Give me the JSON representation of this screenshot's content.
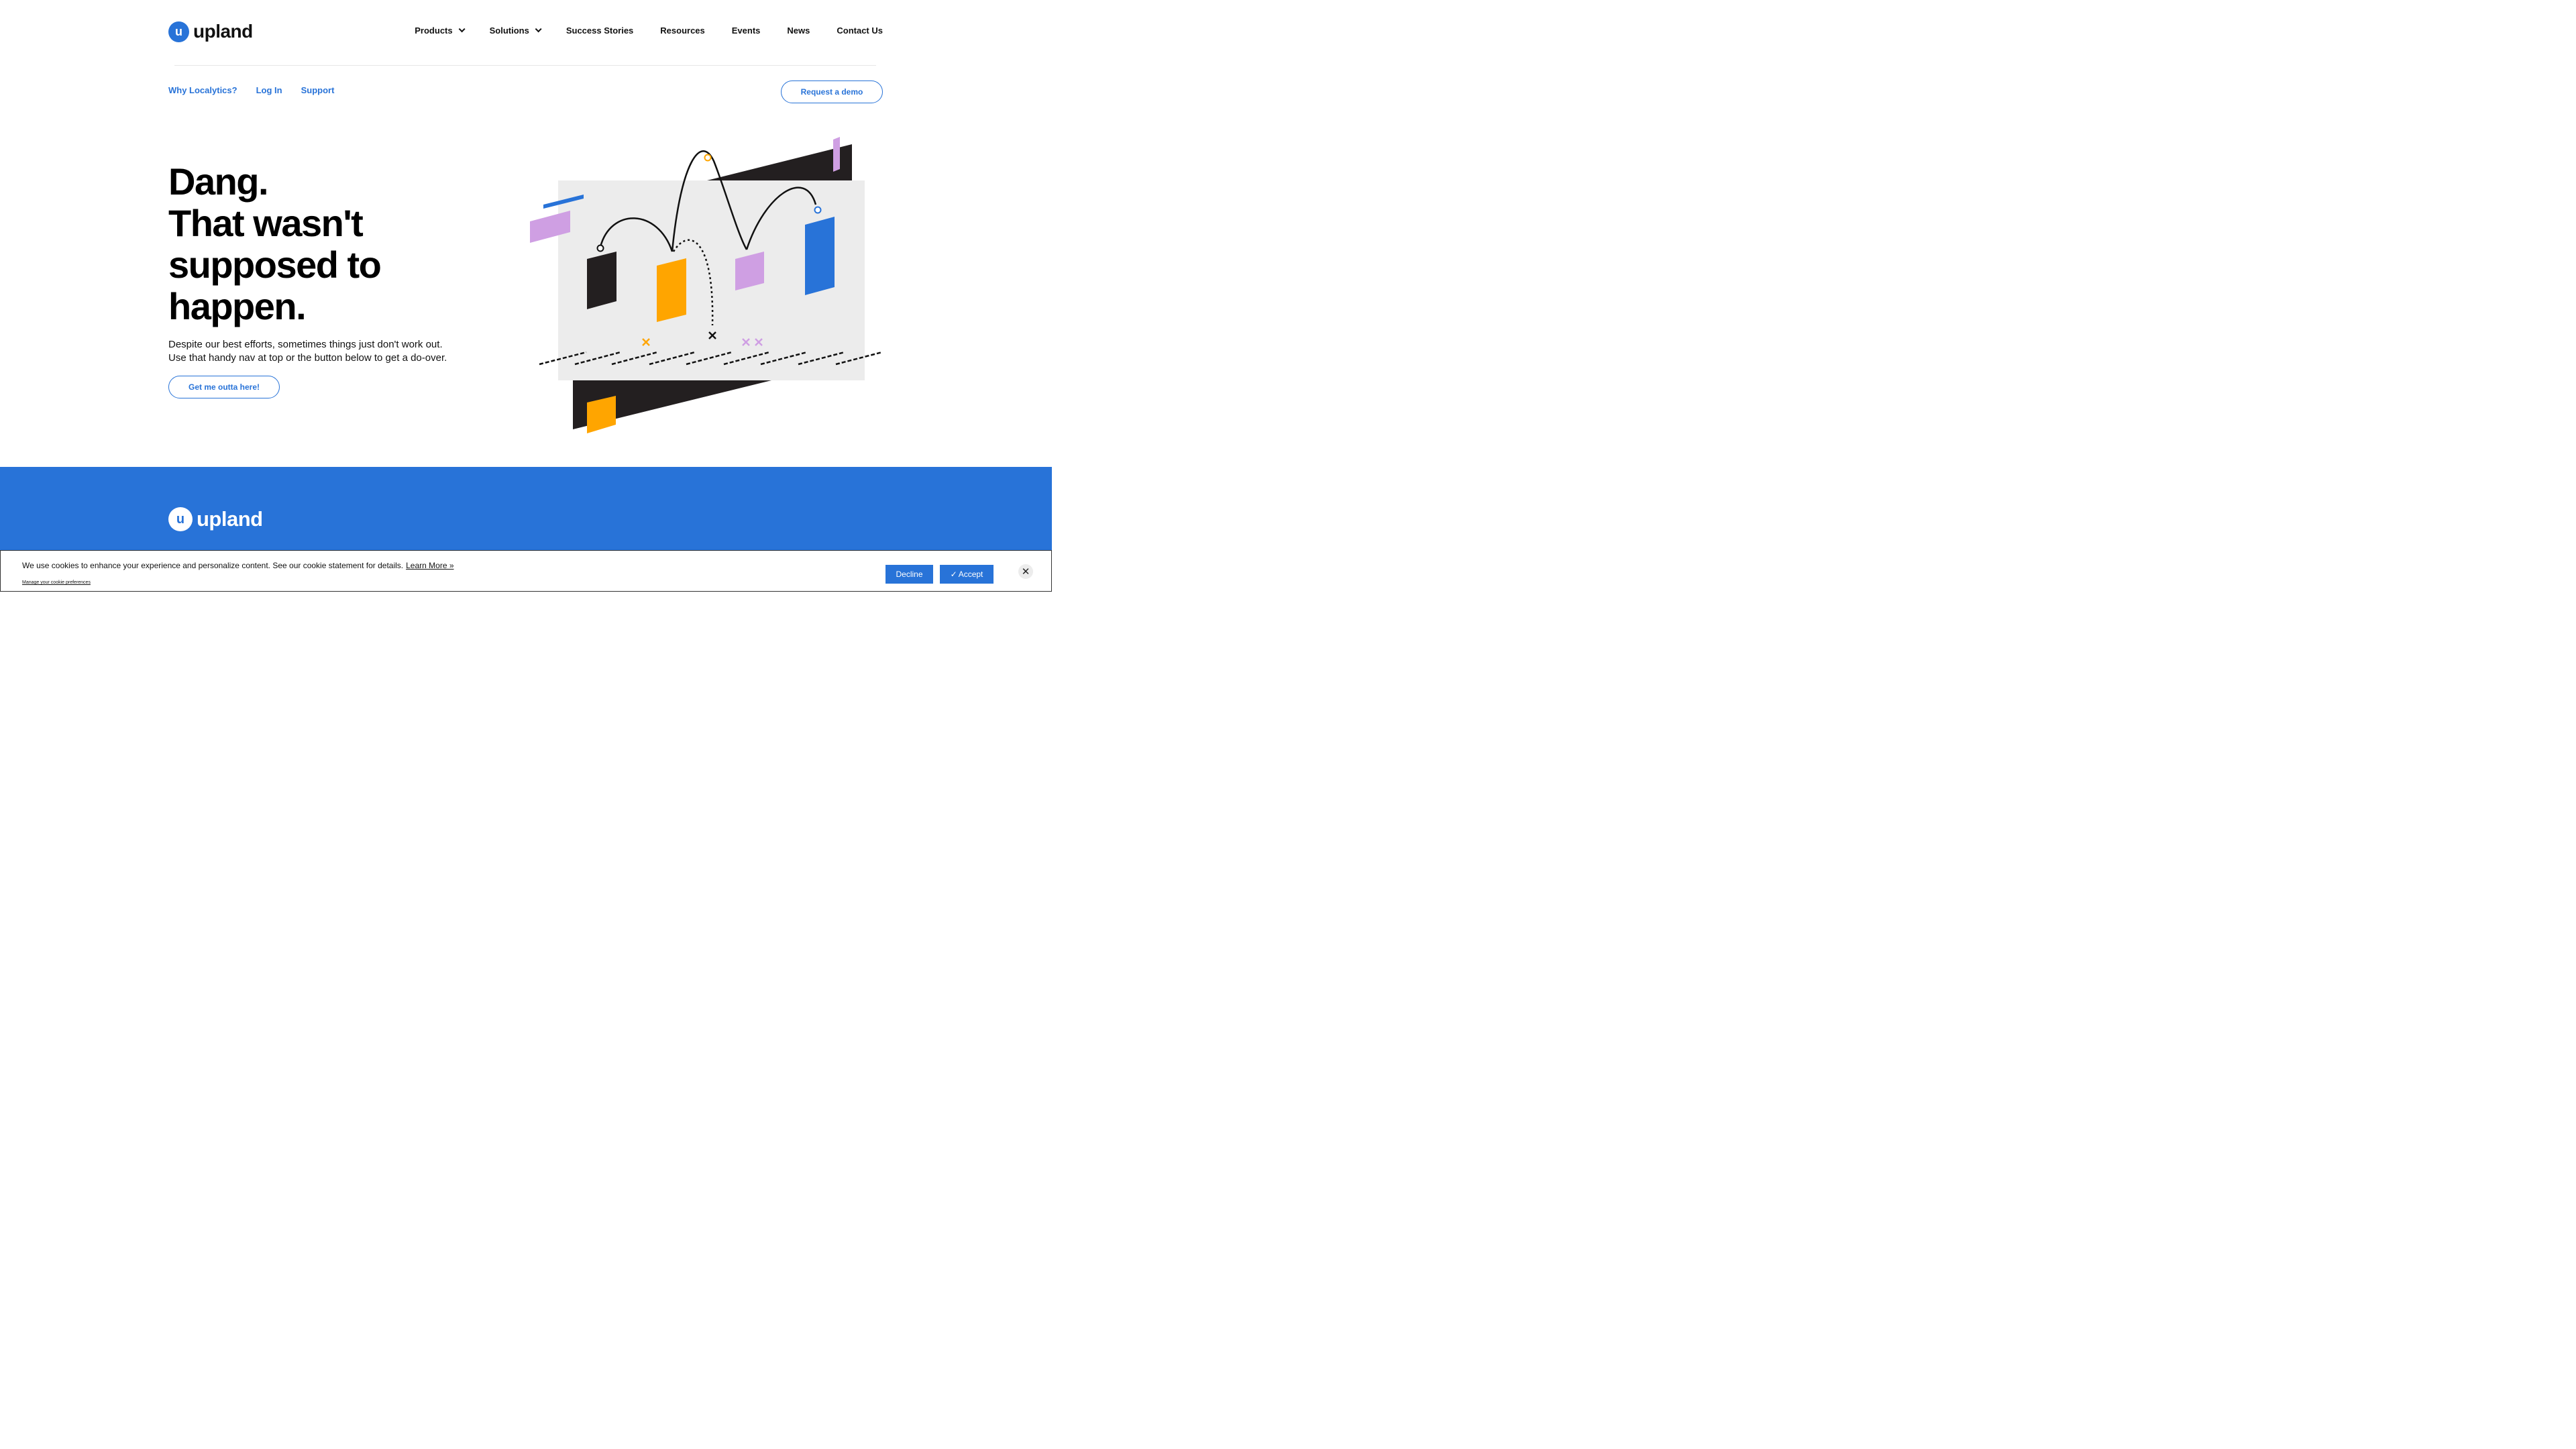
{
  "brand": {
    "logo_letter": "u",
    "name": "upland"
  },
  "nav": {
    "items": [
      {
        "label": "Products",
        "dropdown": true
      },
      {
        "label": "Solutions",
        "dropdown": true
      },
      {
        "label": "Success Stories"
      },
      {
        "label": "Resources"
      },
      {
        "label": "Events"
      },
      {
        "label": "News"
      },
      {
        "label": "Contact Us"
      }
    ]
  },
  "subnav": {
    "links": [
      "Why Localytics?",
      "Log In",
      "Support"
    ],
    "demo_button": "Request a demo"
  },
  "hero": {
    "title_lines": [
      "Dang.",
      "That wasn't",
      "supposed to",
      "happen."
    ],
    "body_lines": [
      "Despite our best efforts, sometimes things just don't work out.",
      "Use that handy nav at top or the button below to get a do-over."
    ],
    "cta": "Get me outta here!"
  },
  "footer": {
    "logo_letter": "u",
    "name": "upland"
  },
  "cookie": {
    "text": "We use cookies to enhance your experience and personalize content. See our cookie statement for details.",
    "learn_more": "Learn More »",
    "manage": "Manage your cookie preferences",
    "decline": "Decline",
    "accept": "Accept",
    "accept_icon": "✓",
    "close": "✕"
  },
  "colors": {
    "accent": "#2873d8",
    "orange": "#ffa500",
    "purple": "#cf9fe3",
    "black": "#231f20"
  }
}
